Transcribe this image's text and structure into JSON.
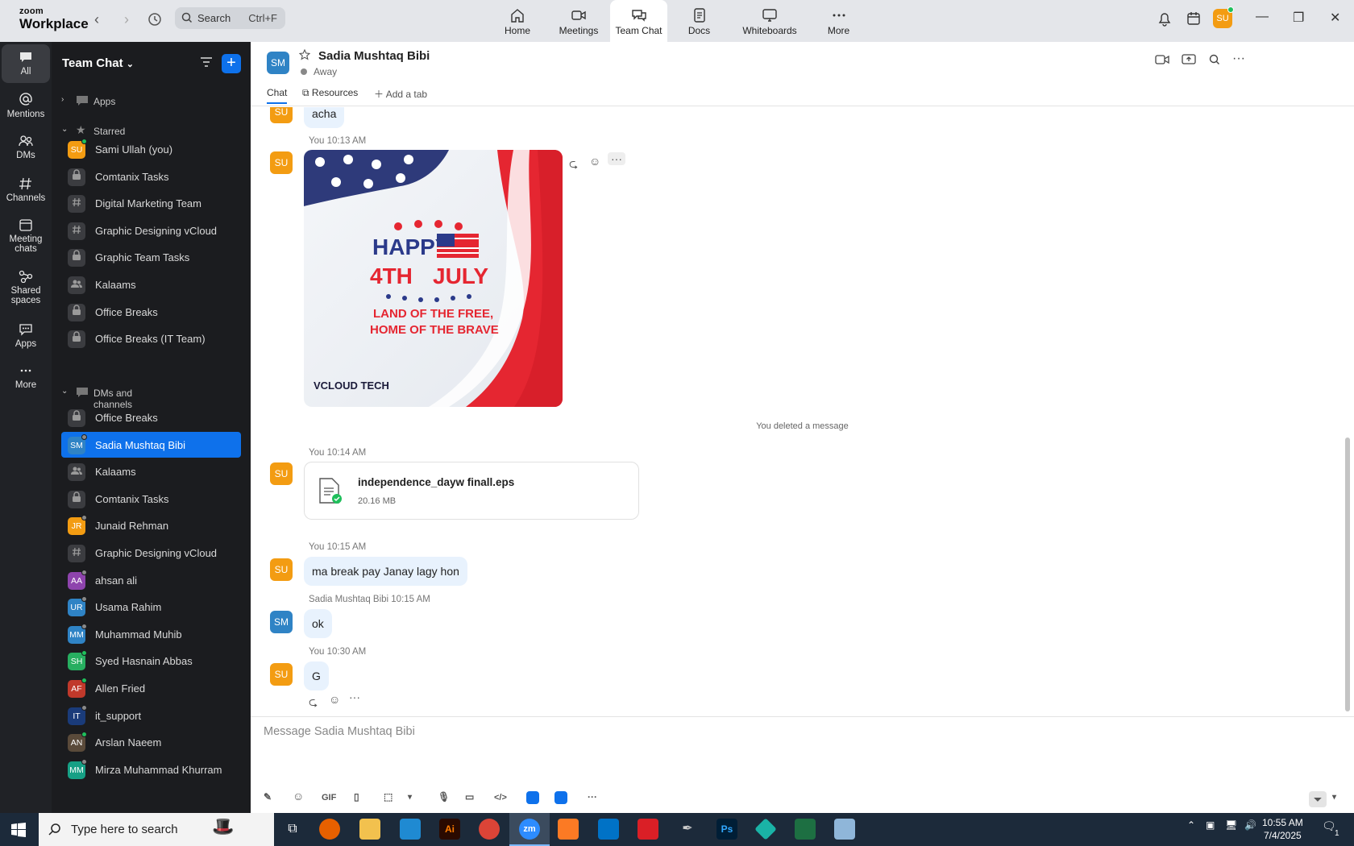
{
  "app": {
    "brand_top": "zoom",
    "brand_bottom": "Workplace"
  },
  "search": {
    "label": "Search",
    "shortcut": "Ctrl+F"
  },
  "top_tabs": [
    {
      "label": "Home",
      "icon": "home-icon"
    },
    {
      "label": "Meetings",
      "icon": "video-icon"
    },
    {
      "label": "Team Chat",
      "icon": "chat-icon",
      "active": true
    },
    {
      "label": "Docs",
      "icon": "doc-icon"
    },
    {
      "label": "Whiteboards",
      "icon": "whiteboard-icon"
    },
    {
      "label": "More",
      "icon": "more-icon"
    }
  ],
  "user_avatar": "SU",
  "rail": [
    {
      "label": "All",
      "icon": "chat-bubble-icon",
      "active": true
    },
    {
      "label": "Mentions",
      "icon": "at-icon"
    },
    {
      "label": "DMs",
      "icon": "people-icon"
    },
    {
      "label": "Channels",
      "icon": "hash-icon"
    },
    {
      "label": "Meeting chats",
      "icon": "calendar-icon"
    },
    {
      "label": "Shared spaces",
      "icon": "shared-icon"
    },
    {
      "label": "Apps",
      "icon": "apps-icon"
    },
    {
      "label": "More",
      "icon": "more-icon"
    }
  ],
  "sidebar": {
    "title": "Team Chat",
    "sections": {
      "apps": "Apps",
      "starred": "Starred",
      "dms": "DMs and channels"
    },
    "starred": [
      {
        "label": "Sami Ullah (you)",
        "type": "avatar",
        "initials": "SU",
        "color": "#f39c12"
      },
      {
        "label": "Comtanix Tasks",
        "type": "lock"
      },
      {
        "label": "Digital Marketing Team",
        "type": "hash"
      },
      {
        "label": "Graphic Designing vCloud",
        "type": "hash"
      },
      {
        "label": "Graphic Team Tasks",
        "type": "lock"
      },
      {
        "label": "Kalaams",
        "type": "group"
      },
      {
        "label": "Office Breaks",
        "type": "lock"
      },
      {
        "label": "Office Breaks (IT Team)",
        "type": "lock"
      }
    ],
    "dms": [
      {
        "label": "Office Breaks",
        "type": "lock"
      },
      {
        "label": "Sadia Mushtaq Bibi",
        "type": "avatar",
        "initials": "SM",
        "color": "#2f83c5",
        "selected": true
      },
      {
        "label": "Kalaams",
        "type": "group"
      },
      {
        "label": "Comtanix Tasks",
        "type": "lock"
      },
      {
        "label": "Junaid Rehman",
        "type": "avatar",
        "initials": "JR",
        "color": "#f39c12"
      },
      {
        "label": "Graphic Designing vCloud",
        "type": "hash"
      },
      {
        "label": "ahsan ali",
        "type": "avatar",
        "initials": "AA",
        "color": "#8e44ad"
      },
      {
        "label": "Usama Rahim",
        "type": "avatar",
        "initials": "UR",
        "color": "#2f83c5"
      },
      {
        "label": "Muhammad Muhib",
        "type": "avatar",
        "initials": "MM",
        "color": "#2f83c5"
      },
      {
        "label": "Syed Hasnain Abbas",
        "type": "avatar",
        "initials": "SH",
        "color": "#27ae60"
      },
      {
        "label": "Allen Fried",
        "type": "avatar",
        "initials": "AF",
        "color": "#c0392b"
      },
      {
        "label": "it_support",
        "type": "avatar",
        "initials": "IT",
        "color": "#1a3b7a"
      },
      {
        "label": "Arslan Naeem",
        "type": "avatar",
        "initials": "AN",
        "color": "#5a4a3a"
      },
      {
        "label": "Mirza Muhammad Khurram",
        "type": "avatar",
        "initials": "MM",
        "color": "#16a085"
      }
    ]
  },
  "chat": {
    "contact_initials": "SM",
    "contact_name": "Sadia Mushtaq Bibi",
    "status": "Away",
    "tabs": {
      "chat": "Chat",
      "resources": "Resources",
      "add": "Add a tab"
    },
    "messages": {
      "m0_text": "acha",
      "m1_meta": "You 10:13 AM",
      "image": {
        "l1": "HAPPY",
        "l2": "4TH",
        "l3": "JULY",
        "l4": "LAND OF THE FREE,",
        "l5": "HOME OF THE BRAVE",
        "brand": "VCLOUD TECH"
      },
      "deleted": "You deleted a message",
      "m2_meta": "You 10:14 AM",
      "file_name": "independence_dayw finall.eps",
      "file_size": "20.16 MB",
      "m3_meta": "You 10:15 AM",
      "m3_text": "ma break pay Janay lagy hon",
      "m4_meta": "Sadia Mushtaq Bibi 10:15 AM",
      "m4_text": "ok",
      "m5_meta": "You 10:30 AM",
      "m5_text": "G"
    },
    "sender_initials_self": "SU",
    "sender_initials_other": "SM",
    "composer_placeholder": "Message Sadia Mushtaq Bibi",
    "gif_label": "GIF"
  },
  "taskbar": {
    "search_text": "Type here to search",
    "zoom_label": "zm",
    "time": "10:55 AM",
    "date": "7/4/2025",
    "notif_count": "1"
  }
}
